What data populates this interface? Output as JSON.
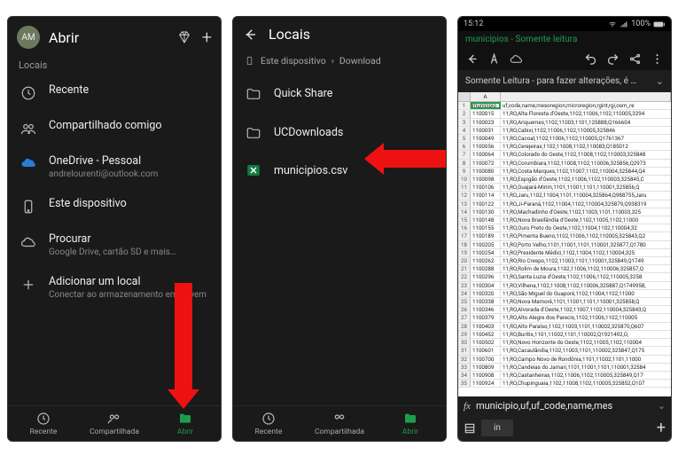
{
  "screen1": {
    "avatar": "AM",
    "title": "Abrir",
    "section": "Locais",
    "items": [
      {
        "icon": "clock",
        "label": "Recente",
        "sub": ""
      },
      {
        "icon": "people",
        "label": "Compartilhado comigo",
        "sub": ""
      },
      {
        "icon": "cloud-blue",
        "label": "OneDrive - Pessoal",
        "sub": "andrelourenti@outlook.com"
      },
      {
        "icon": "device",
        "label": "Este dispositivo",
        "sub": ""
      },
      {
        "icon": "cloud",
        "label": "Procurar",
        "sub": "Google Drive, cartão SD e mais…"
      },
      {
        "icon": "plus",
        "label": "Adicionar um local",
        "sub": "Conectar ao armazenamento em nuvem"
      }
    ],
    "tabs": [
      {
        "icon": "clock",
        "label": "Recente",
        "active": false
      },
      {
        "icon": "people",
        "label": "Compartilhada",
        "active": false
      },
      {
        "icon": "folder",
        "label": "Abrir",
        "active": true
      }
    ]
  },
  "screen2": {
    "title": "Locais",
    "crumb1": "Este dispositivo",
    "crumb2": "Download",
    "items": [
      {
        "icon": "folder",
        "label": "Quick Share"
      },
      {
        "icon": "folder",
        "label": "UCDownloads"
      },
      {
        "icon": "excel",
        "label": "municipios.csv"
      }
    ],
    "tabs": [
      {
        "icon": "clock",
        "label": "Recente",
        "active": false
      },
      {
        "icon": "people",
        "label": "Compartilhada",
        "active": false
      },
      {
        "icon": "folder",
        "label": "Abrir",
        "active": true
      }
    ]
  },
  "screen3": {
    "time": "15:12",
    "battery": "100%",
    "docbar": "municipios - Somente leitura",
    "notice": "Somente Leitura - para fazer alterações, é …",
    "colA": "A",
    "rows": [
      "municipio,uf,code,name,mesoregion,microregion,rgint,rgi,osm_re",
      "1100015,11,RO,Alta Floresta d'Oeste,1102,11006,1102,110005,3294",
      "1100023,11,RO,Ariquemes,1102,11003,1101,125888,Q166604",
      "1100031,11,RO,Cabixi,1102,11006,1102,110005,325846",
      "1100049,11,RO,Cacoal,1102,11006,1102,110005,Q1761367",
      "1100056,11,RO,Cerejeiras,1102,11008,1102,110083,Q185012",
      "1100064,11,RO,Colorado do Oeste,1102,11008,1102,110003,325848",
      "1100072,11,RO,Corumbiara,1102,11008,1102,110006,325856,Q2973",
      "1100080,11,RO,Costa Marques,1102,11007,1102,110004,325844,Q4",
      "1100098,11,RO,Espigão d'Oeste,1102,11006,1102,110003,325845,C",
      "1100106,11,RO,Guajará-Mirim,1101,11001,1101,110001,325856,Q",
      "1100114,11,RO,Jaru,1102,11004,1101,110004,325864,Q988755,Jaru",
      "1100122,11,RO,Ji-Paraná,1102,11004,1102,110004,325879,Q938319",
      "1100130,11,RO,Machadinho d'Oeste,1102,11003,1101,110003,325",
      "1100148,11,RO,Nova Brasilândia d'Oeste,1102,11005,1102,11000",
      "1100155,11,RO,Ouro Preto do Oeste,1102,11004,1102,110004,32",
      "1100189,11,RO,Pimenta Bueno,1102,11006,1102,110005,325843,Q2",
      "1100205,11,RO,Porto Velho,1101,11001,1101,110001,325877,Q1780",
      "1100254,11,RO,Presidente Médici,1102,11004,1102,110004,325",
      "1100262,11,RO,Rio Crespo,1102,11003,1101,110001,325849,Q1749",
      "1100288,11,RO,Rolim de Moura,1102,11006,1102,110006,325857,Q",
      "1100296,11,RO,Santa Luzia d'Oeste,1102,11006,1102,110005,3258",
      "1100304,11,RO,Vilhena,1102,11008,1102,110006,325887,Q1749958,",
      "1100320,11,RO,São Miguel do Guaporé,1102,11004,1102,11000",
      "1100338,11,RO,Nova Mamoré,1101,11001,1101,110001,325858,Q",
      "1100346,11,RO,Alvorada d'Oeste,1102,11007,1102,110004,325843,Q",
      "1100379,11,RO,Alto Alegre dos Parecis,1102,11006,1102,110005",
      "1100403,11,RO,Alto Paraíso,1102,11003,1101,110002,325870,Q607",
      "1100452,11,RO,Buritis,1101,11002,1101,110002,Q1921492,O,",
      "1100502,11,RO,Novo Horizonte do Oeste,1102,11005,1102,110004",
      "1100601,11,RO,Cacaulândia,1102,11003,1101,110002,325847,Q175",
      "1100700,11,RO,Campo Novo de Rondônia,1101,11002,1101,11000",
      "1100809,11,RO,Candeias do Jamari,1101,11001,1101,110001,32584",
      "1100908,11,RO,Castanheiras,1102,11006,1102,110005,325849,Q17",
      "1100924,11,RO,Chupinguaia,1102,11008,1102,110005,325852,Q107"
    ],
    "fx": "municipio,uf,uf_code,name,mes",
    "sheet_tab": "in"
  }
}
